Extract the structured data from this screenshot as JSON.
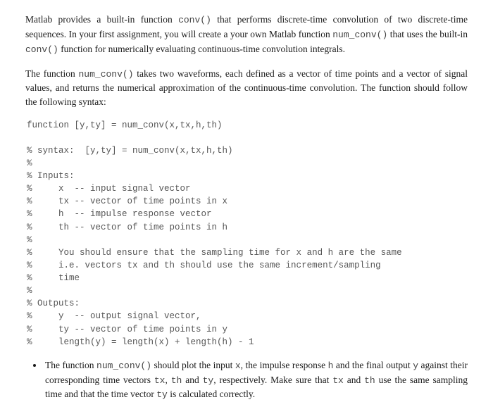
{
  "para1_pre": "Matlab provides a built-in function ",
  "para1_code1": "conv()",
  "para1_mid1": " that performs discrete-time convolution of two discrete-time sequences. In your first assignment, you will create a your own Matlab function ",
  "para1_code2": "num_conv()",
  "para1_mid2": " that uses the built-in ",
  "para1_code3": "conv()",
  "para1_post": " function for numerically evaluating continuous-time convolution integrals.",
  "para2_pre": "The function ",
  "para2_code1": "num_conv()",
  "para2_post": " takes two waveforms, each defined as a vector of time points and a vector of signal values, and returns the numerical approximation of the continuous-time convolution. The function should follow the following syntax:",
  "code_block": "function [y,ty] = num_conv(x,tx,h,th)\n\n% syntax:  [y,ty] = num_conv(x,tx,h,th)\n%\n% Inputs:\n%     x  -- input signal vector\n%     tx -- vector of time points in x\n%     h  -- impulse response vector\n%     th -- vector of time points in h\n%\n%     You should ensure that the sampling time for x and h are the same\n%     i.e. vectors tx and th should use the same increment/sampling\n%     time\n%\n% Outputs:\n%     y  -- output signal vector,\n%     ty -- vector of time points in y\n%     length(y) = length(x) + length(h) - 1",
  "bullet_pre": "The function ",
  "bullet_code1": "num_conv()",
  "bullet_mid1": " should plot the input ",
  "bullet_code2": "x",
  "bullet_mid2": ", the impulse response ",
  "bullet_code3": "h",
  "bullet_mid3": " and the final output ",
  "bullet_code4": "y",
  "bullet_mid4": " against their corresponding time vectors ",
  "bullet_code5": "tx",
  "bullet_mid5": ", ",
  "bullet_code6": "th",
  "bullet_mid6": " and ",
  "bullet_code7": "ty",
  "bullet_mid7": ", respectively. Make sure that ",
  "bullet_code8": "tx",
  "bullet_mid8": " and ",
  "bullet_code9": "th",
  "bullet_mid9": " use the same sampling time and that the time vector ",
  "bullet_code10": "ty",
  "bullet_post": " is calculated correctly."
}
